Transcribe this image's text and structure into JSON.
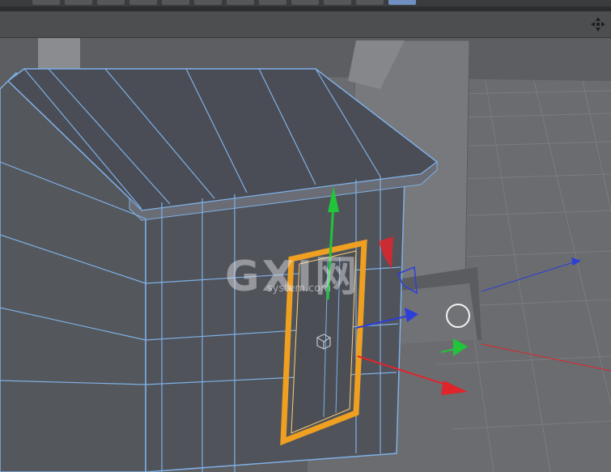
{
  "toolbar": {
    "items": [
      "tool-1",
      "tool-2",
      "tool-3",
      "tool-4",
      "tool-5",
      "tool-6",
      "tool-7",
      "tool-8",
      "tool-9",
      "tool-10",
      "tool-11",
      "tool-12"
    ],
    "active_index": 11
  },
  "viewport": {
    "nav_icon": "move-view-icon",
    "selected_object": "door-frame",
    "axis_colors": {
      "x": "#e0242c",
      "y": "#21c43a",
      "z": "#2d3fd9"
    },
    "selection_color": "#f0a020",
    "wireframe_color": "#7fb0e6"
  },
  "watermark": {
    "logo": "GXI网",
    "sub": "system.com"
  }
}
